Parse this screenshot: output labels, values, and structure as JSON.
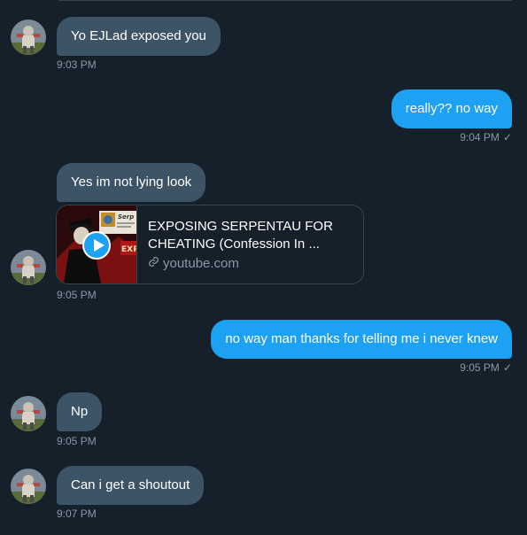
{
  "conversation": {
    "messages": [
      {
        "text": "Yo EJLad exposed you",
        "time": "9:03 PM",
        "direction": "in"
      },
      {
        "text": "really?? no way",
        "time": "9:04 PM",
        "direction": "out"
      },
      {
        "text": "Yes im not lying look",
        "direction": "in"
      },
      {
        "text": "no way man thanks for telling me i never knew",
        "time": "9:05 PM",
        "direction": "out"
      },
      {
        "text": "Np",
        "time": "9:05 PM",
        "direction": "in"
      },
      {
        "text": "Can i get a shoutout",
        "time": "9:07 PM",
        "direction": "in"
      }
    ],
    "link_card": {
      "title": "EXPOSING SERPENTAU FOR CHEATING (Confession In ...",
      "domain": "youtube.com",
      "time": "9:05 PM",
      "thumbnail_text": "Serp",
      "thumbnail_badge": "EXP"
    },
    "read_check": "✓"
  },
  "colors": {
    "background": "#15202b",
    "incoming_bubble": "#3d5466",
    "outgoing_bubble": "#1da1f2",
    "secondary_text": "#8899a6",
    "divider": "#38444d"
  }
}
